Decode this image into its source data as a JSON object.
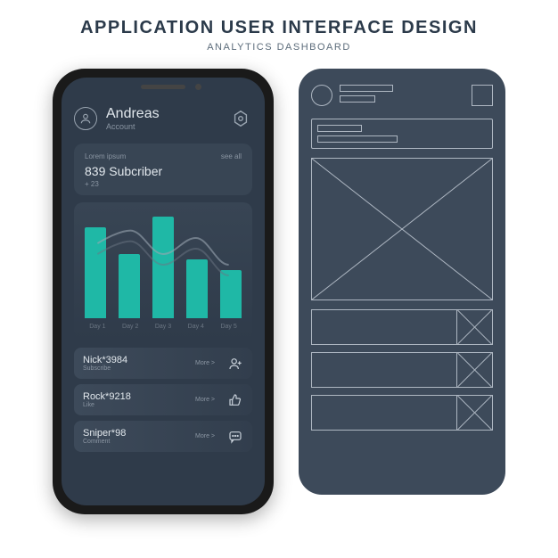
{
  "page": {
    "title": "APPLICATION USER INTERFACE DESIGN",
    "subtitle": "ANALYTICS DASHBOARD"
  },
  "header": {
    "user_name": "Andreas",
    "account_label": "Account"
  },
  "subscriber_card": {
    "lorem": "Lorem ipsum",
    "see_all": "see all",
    "count_text": "839 Subcriber",
    "delta": "+ 23"
  },
  "chart_data": {
    "type": "bar",
    "categories": [
      "Day 1",
      "Day 2",
      "Day 3",
      "Day 4",
      "Day 5"
    ],
    "values": [
      85,
      60,
      95,
      55,
      45
    ],
    "line_values": [
      70,
      82,
      60,
      75,
      50
    ],
    "title": "",
    "xlabel": "",
    "ylabel": "",
    "ylim": [
      0,
      100
    ],
    "bar_color": "#1fb8a6",
    "line_color": "#9aa5b1"
  },
  "activity": [
    {
      "name": "Nick*3984",
      "action": "Subscribe",
      "more": "More >",
      "icon": "user-add-icon"
    },
    {
      "name": "Rock*9218",
      "action": "Like",
      "more": "More >",
      "icon": "thumbs-up-icon"
    },
    {
      "name": "Sniper*98",
      "action": "Comment",
      "more": "More >",
      "icon": "comment-icon"
    }
  ]
}
